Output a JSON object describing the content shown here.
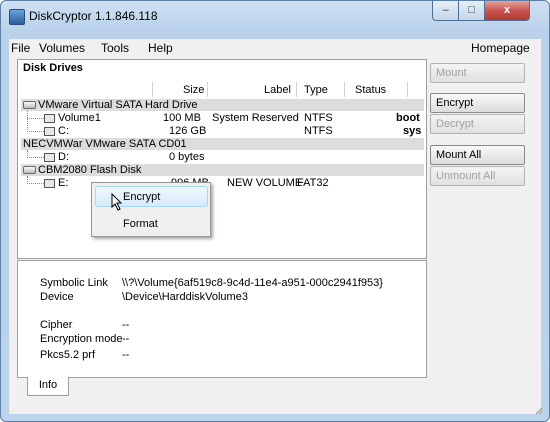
{
  "window": {
    "title": "DiskCryptor 1.1.846.118",
    "close_glyph": "x",
    "min_glyph": "–",
    "max_glyph": "□"
  },
  "menu": {
    "items": [
      "File",
      "Volumes",
      "Tools",
      "Help"
    ],
    "homepage": "Homepage"
  },
  "drives_panel": {
    "title": "Disk Drives",
    "columns": [
      "Size",
      "Label",
      "Type",
      "Status"
    ],
    "groups": [
      {
        "name": "VMware Virtual SATA Hard Drive",
        "volumes": [
          {
            "name": "Volume1",
            "size": "100 MB",
            "label": "System Reserved",
            "type": "NTFS",
            "status": "",
            "flag": "boot"
          },
          {
            "name": "C:",
            "size": "126 GB",
            "label": "",
            "type": "NTFS",
            "status": "",
            "flag": "sys"
          }
        ]
      },
      {
        "name": "NECVMWar VMware SATA CD01",
        "volumes": [
          {
            "name": "D:",
            "size": "0 bytes",
            "label": "",
            "type": "",
            "status": "",
            "flag": ""
          }
        ]
      },
      {
        "name": "CBM2080 Flash Disk",
        "volumes": [
          {
            "name": "E:",
            "size": "996 MB",
            "label": "NEW VOLUME",
            "type": "FAT32",
            "status": "",
            "flag": ""
          }
        ]
      }
    ]
  },
  "context_menu": {
    "items": [
      "Encrypt",
      "Format"
    ],
    "highlighted": "Encrypt"
  },
  "info_panel": {
    "symbolic_link_label": "Symbolic Link",
    "symbolic_link_value": "\\\\?\\Volume{6af519c8-9c4d-11e4-a951-000c2941f953}",
    "device_label": "Device",
    "device_value": "\\Device\\HarddiskVolume3",
    "cipher_label": "Cipher",
    "cipher_value": "--",
    "encryption_mode_label": "Encryption mode",
    "encryption_mode_value": "--",
    "pkcs_label": "Pkcs5.2 prf",
    "pkcs_value": "--"
  },
  "tabs": {
    "info": "Info"
  },
  "buttons": {
    "mount": "Mount",
    "encrypt": "Encrypt",
    "decrypt": "Decrypt",
    "mount_all": "Mount All",
    "unmount_all": "Unmount All"
  },
  "colors": {
    "selection": "#d5ecfb",
    "group_row": "#dcdcdc",
    "close": "#c75050"
  }
}
